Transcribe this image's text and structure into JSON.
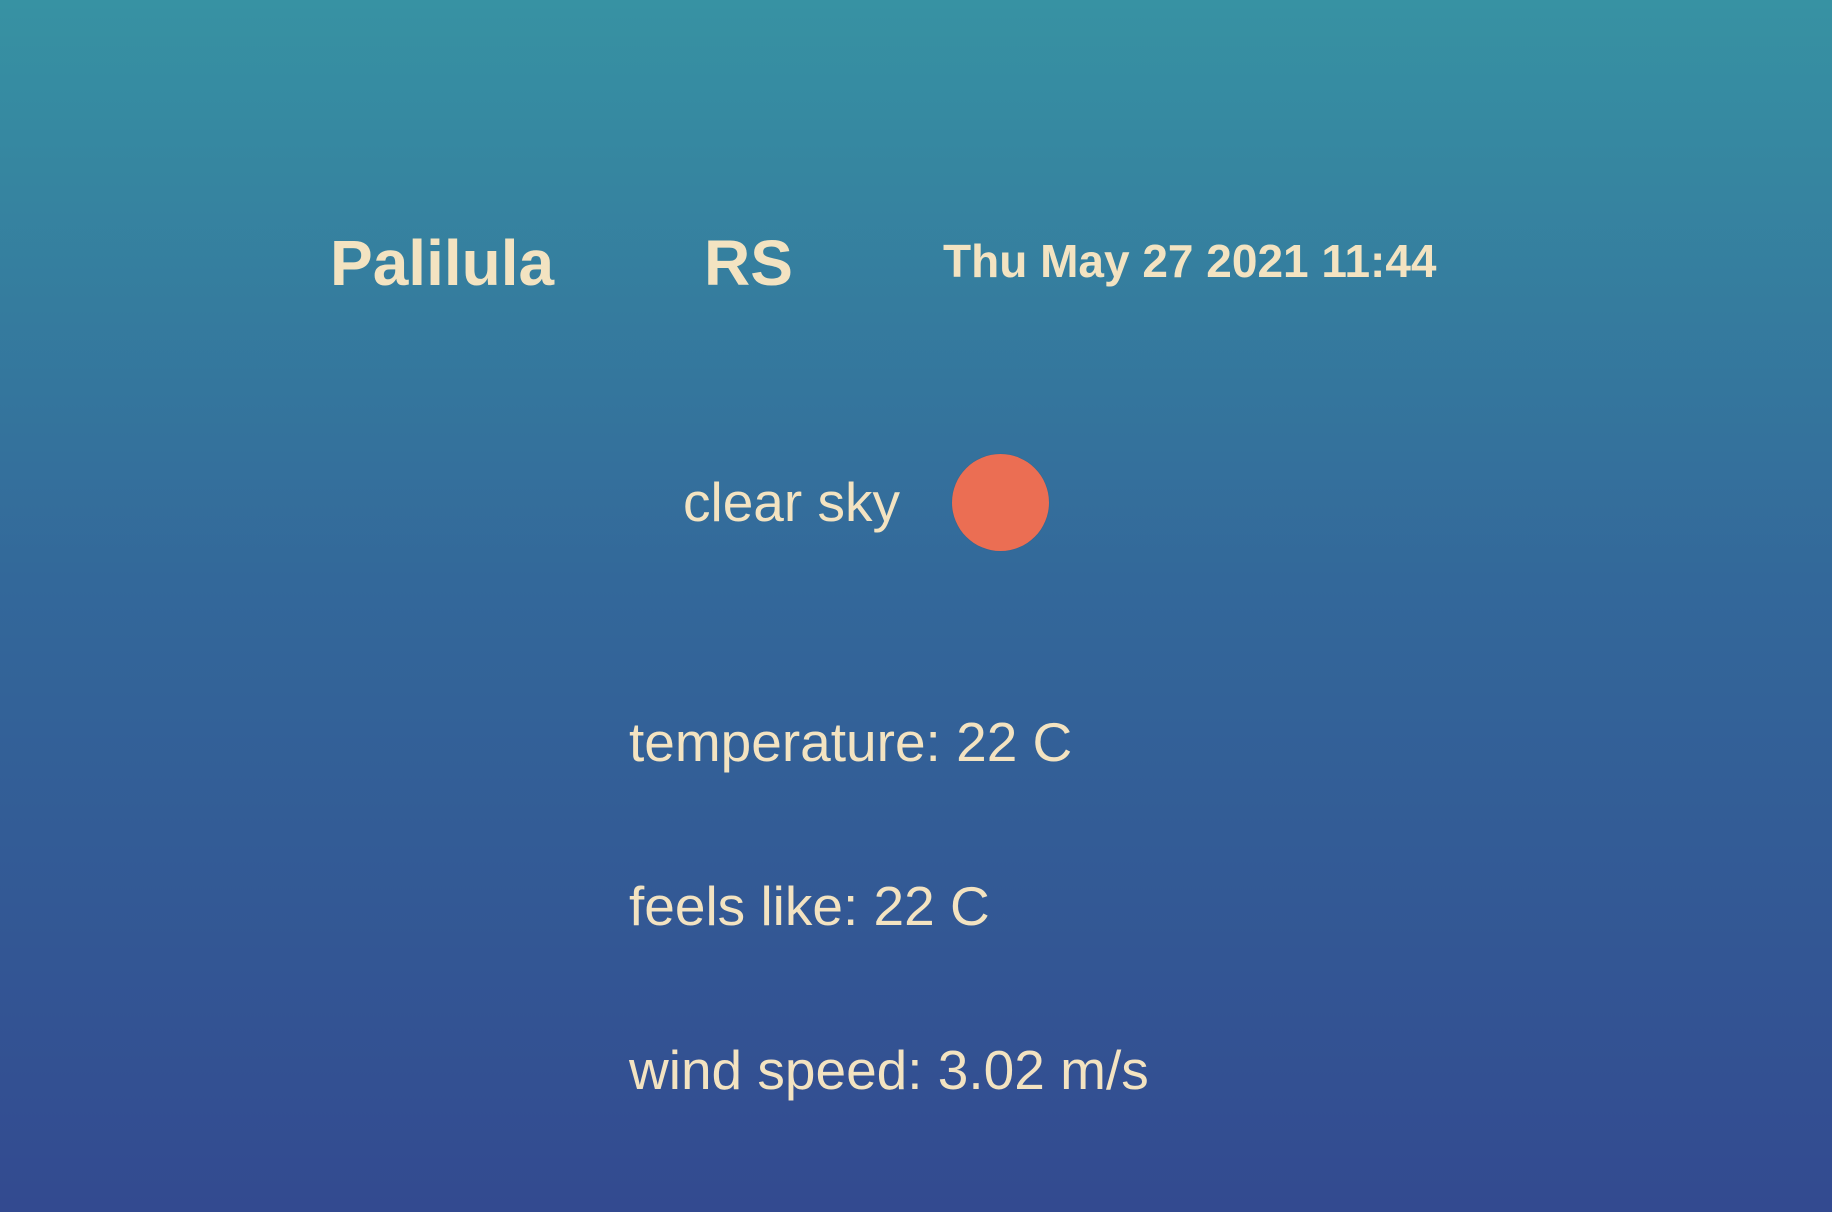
{
  "location": {
    "city": "Palilula",
    "country": "RS"
  },
  "datetime": "Thu May 27 2021 11:44",
  "weather": {
    "description": "clear sky",
    "icon": "sun-icon",
    "icon_color": "#eb6e53"
  },
  "details": {
    "temperature": "temperature: 22 C",
    "feels_like": "feels like: 22 C",
    "wind_speed": "wind speed: 3.02 m/s"
  },
  "colors": {
    "text": "#f3e3c1",
    "background_top": "#3792a3",
    "background_bottom": "#334a90"
  }
}
